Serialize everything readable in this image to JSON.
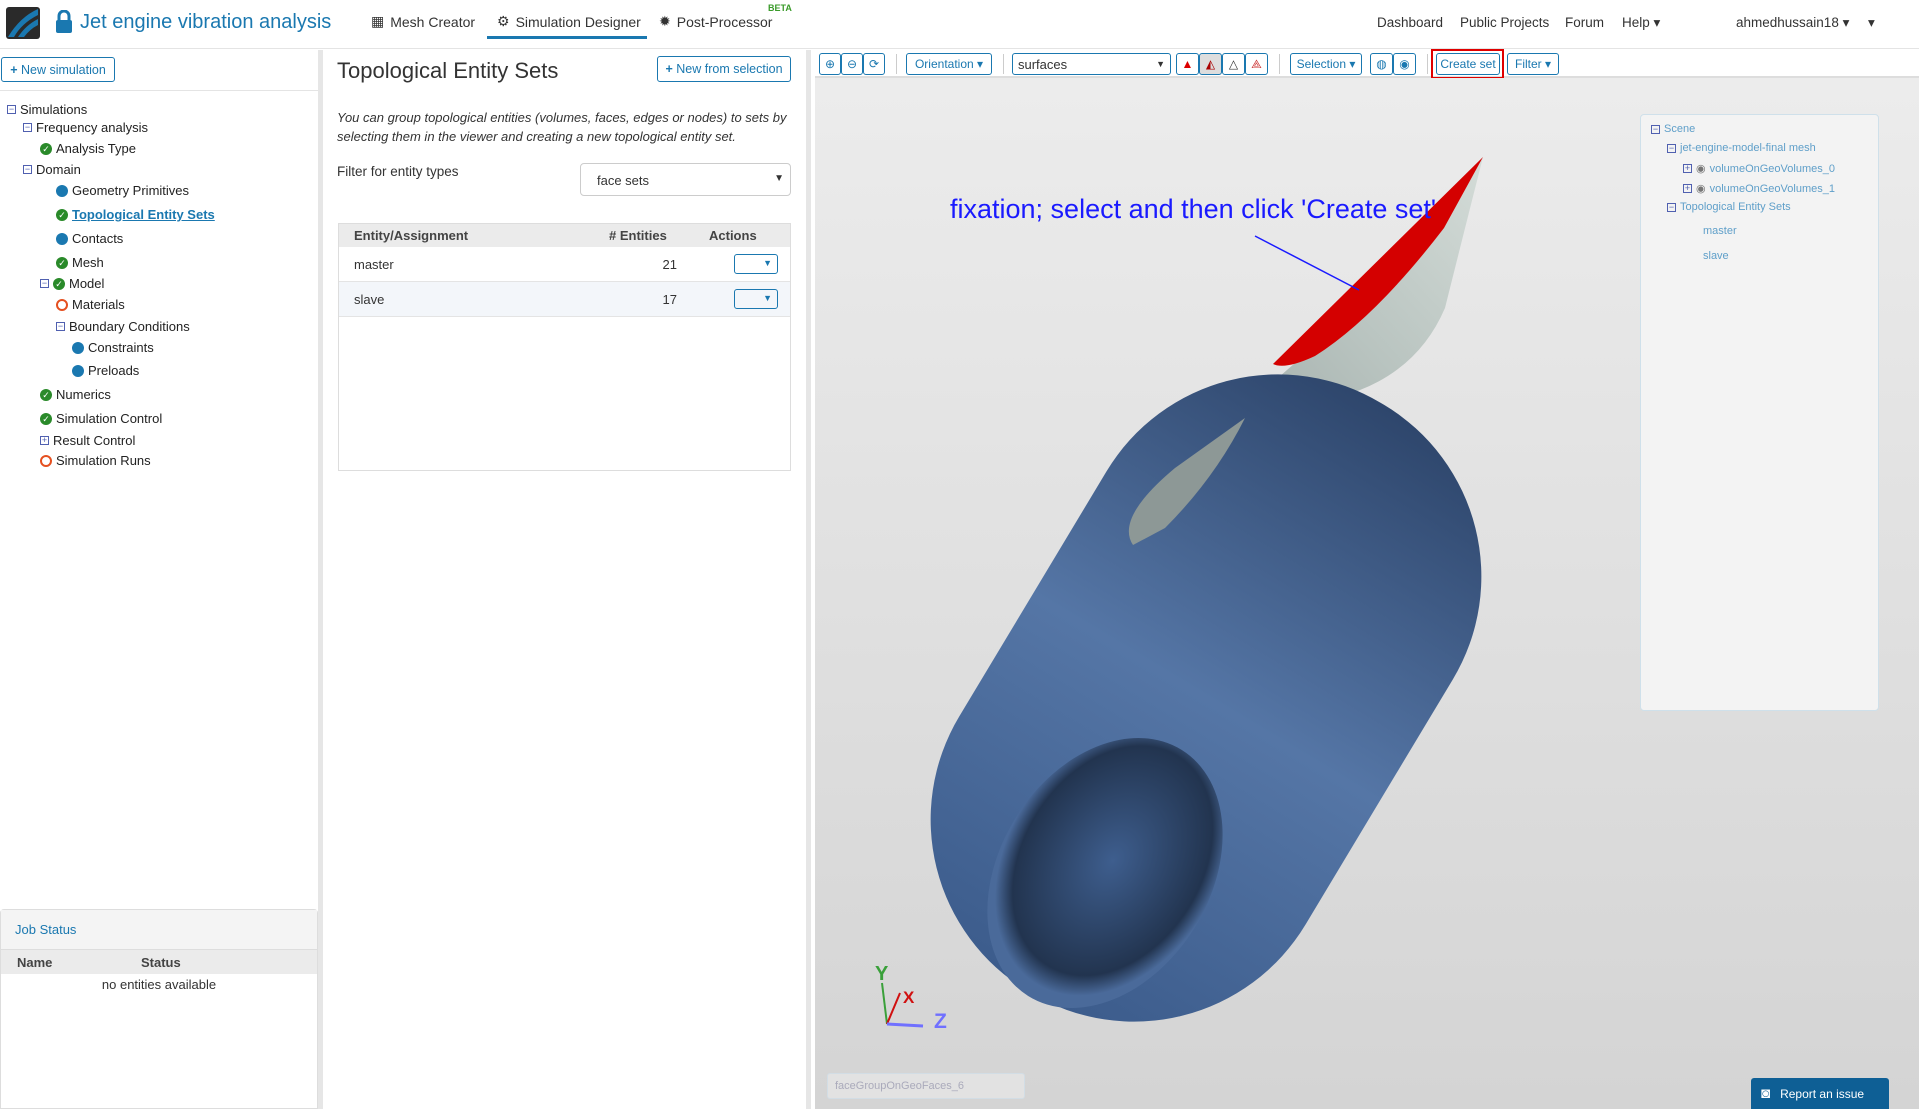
{
  "header": {
    "title": "Jet engine vibration analysis",
    "nav": [
      {
        "label": "Mesh Creator"
      },
      {
        "label": "Simulation Designer"
      },
      {
        "label": "Post-Processor"
      }
    ],
    "beta": "BETA",
    "right": [
      {
        "label": "Dashboard"
      },
      {
        "label": "Public Projects"
      },
      {
        "label": "Forum"
      },
      {
        "label": "Help"
      }
    ],
    "user": "ahmedhussain18"
  },
  "left": {
    "new_simulation": "New simulation",
    "tree": [
      {
        "label": "Simulations",
        "icon": "minus"
      },
      {
        "label": "Frequency analysis",
        "icon": "minus"
      },
      {
        "label": "Analysis Type",
        "icon": "check"
      },
      {
        "label": "Domain",
        "icon": "minus"
      },
      {
        "label": "Geometry Primitives",
        "icon": "dot"
      },
      {
        "label": "Topological Entity Sets",
        "icon": "check"
      },
      {
        "label": "Contacts",
        "icon": "dot"
      },
      {
        "label": "Mesh",
        "icon": "check"
      },
      {
        "label": "Model",
        "icon": "minus-check"
      },
      {
        "label": "Materials",
        "icon": "ring"
      },
      {
        "label": "Boundary Conditions",
        "icon": "minus"
      },
      {
        "label": "Constraints",
        "icon": "dot"
      },
      {
        "label": "Preloads",
        "icon": "dot"
      },
      {
        "label": "Numerics",
        "icon": "check"
      },
      {
        "label": "Simulation Control",
        "icon": "check"
      },
      {
        "label": "Result Control",
        "icon": "plus"
      },
      {
        "label": "Simulation Runs",
        "icon": "ring"
      }
    ],
    "job_status": {
      "title": "Job Status",
      "columns": [
        "Name",
        "Status"
      ],
      "empty": "no entities available"
    }
  },
  "middle": {
    "title": "Topological Entity Sets",
    "new_from_selection": "New from selection",
    "description": "You can group topological entities (volumes, faces, edges or nodes) to sets by selecting them in the viewer and creating a new topological entity set.",
    "filter_label": "Filter for entity types",
    "filter_value": "face sets",
    "columns": [
      "Entity/Assignment",
      "# Entities",
      "Actions"
    ],
    "rows": [
      {
        "name": "master",
        "count": "21"
      },
      {
        "name": "slave",
        "count": "17"
      }
    ]
  },
  "toolbar": {
    "orientation": "Orientation",
    "surfaces": "surfaces",
    "selection": "Selection",
    "create_set": "Create set",
    "filter": "Filter"
  },
  "viewer": {
    "annotation": "fixation; select and then click 'Create set'",
    "axes": {
      "x": "X",
      "y": "Y",
      "z": "Z"
    },
    "selection_field": "faceGroupOnGeoFaces_6",
    "report": "Report an issue",
    "scene": {
      "root": "Scene",
      "mesh": "jet-engine-model-final mesh",
      "volumes": [
        "volumeOnGeoVolumes_0",
        "volumeOnGeoVolumes_1"
      ],
      "sets_label": "Topological Entity Sets",
      "sets": [
        "master",
        "slave"
      ]
    },
    "colors": {
      "nacelle": "#4a6a9a",
      "pylon": "#a8b4b0",
      "selected": "#d40000",
      "annotation": "#1a1aff"
    }
  }
}
